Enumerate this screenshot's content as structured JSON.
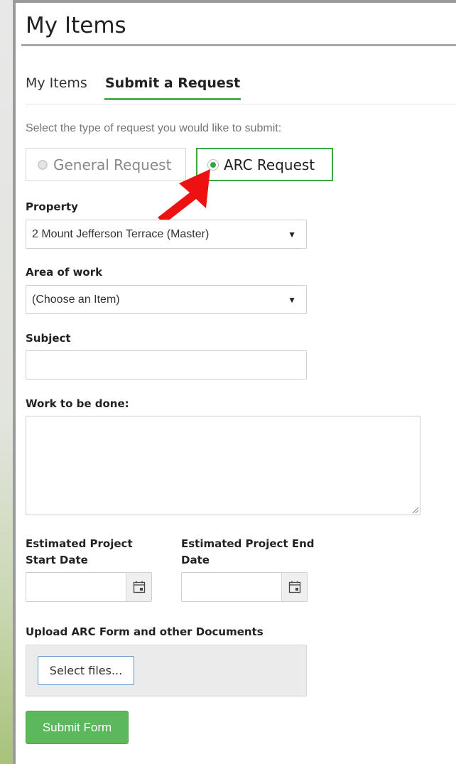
{
  "page": {
    "title": "My Items"
  },
  "tabs": [
    {
      "label": "My Items"
    },
    {
      "label": "Submit a Request"
    }
  ],
  "form": {
    "instruction": "Select the type of request you would like to submit:",
    "request_types": [
      {
        "label": "General Request",
        "selected": false
      },
      {
        "label": "ARC Request",
        "selected": true
      }
    ],
    "property": {
      "label": "Property",
      "value": "2 Mount Jefferson Terrace (Master)"
    },
    "area_of_work": {
      "label": "Area of work",
      "value": "(Choose an Item)"
    },
    "subject": {
      "label": "Subject",
      "value": ""
    },
    "work_to_be_done": {
      "label": "Work to be done:",
      "value": ""
    },
    "start_date": {
      "label_line1": "Estimated Project",
      "label_line2": "Start Date",
      "value": ""
    },
    "end_date": {
      "label_line1": "Estimated Project End",
      "label_line2": "Date",
      "value": ""
    },
    "upload": {
      "label": "Upload ARC Form and other Documents",
      "button": "Select files..."
    },
    "submit": "Submit Form"
  },
  "colors": {
    "accent_green": "#5cb85c",
    "selected_border": "#3aa845",
    "annotation_arrow": "#ee1111"
  },
  "icons": {
    "dropdown": "caret-down-icon",
    "calendar": "calendar-icon",
    "annotation": "red-arrow-icon"
  }
}
